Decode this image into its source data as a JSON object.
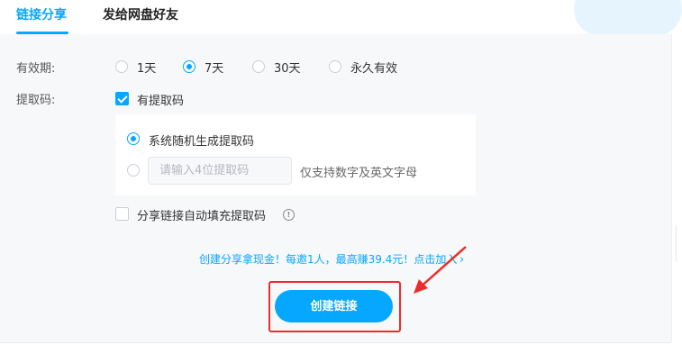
{
  "tabs": [
    {
      "label": "链接分享"
    },
    {
      "label": "发给网盘好友"
    }
  ],
  "validity": {
    "label": "有效期:",
    "options": [
      "1天",
      "7天",
      "30天",
      "永久有效"
    ],
    "selected": "7天"
  },
  "extract_code": {
    "label": "提取码:",
    "has_code_label": "有提取码",
    "has_code_checked": true,
    "random_option": "系统随机生成提取码",
    "custom_placeholder": "请输入4位提取码",
    "custom_hint": "仅支持数字及英文字母",
    "selected": "random"
  },
  "autofill": {
    "label": "分享链接自动填充提取码",
    "checked": false
  },
  "promo": "创建分享拿现金！每邀1人，最高赚39.4元！点击加入",
  "create_button": "创建链接",
  "colors": {
    "accent": "#06a7ff",
    "annotation": "#ee2b2b"
  }
}
